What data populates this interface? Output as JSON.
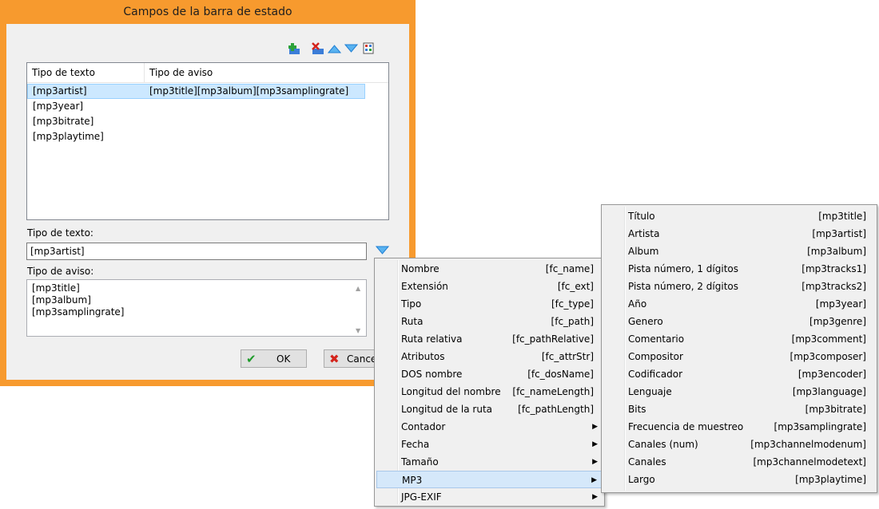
{
  "dialog": {
    "title": "Campos de la barra de estado",
    "toolbar": {
      "add_icon": "add-item-icon",
      "delete_icon": "delete-item-icon",
      "up_icon": "move-up-icon",
      "down_icon": "move-down-icon",
      "settings_icon": "grid-icon"
    },
    "list": {
      "columns": [
        "Tipo de texto",
        "Tipo de aviso"
      ],
      "rows": [
        {
          "text": "[mp3artist]",
          "notice": "[mp3title][mp3album][mp3samplingrate]",
          "selected": true
        },
        {
          "text": "[mp3year]",
          "notice": ""
        },
        {
          "text": "[mp3bitrate]",
          "notice": ""
        },
        {
          "text": "[mp3playtime]",
          "notice": ""
        }
      ]
    },
    "text_type_label": "Tipo de texto:",
    "text_type_value": "[mp3artist]",
    "notice_type_label": "Tipo de aviso:",
    "notice_lines": [
      "[mp3title]",
      "[mp3album]",
      "[mp3samplingrate]"
    ],
    "ok_label": "OK",
    "cancel_label": "Cance"
  },
  "menu_main": {
    "items": [
      {
        "label": "Nombre",
        "value": "[fc_name]"
      },
      {
        "label": "Extensión",
        "value": "[fc_ext]"
      },
      {
        "label": "Tipo",
        "value": "[fc_type]"
      },
      {
        "label": "Ruta",
        "value": "[fc_path]"
      },
      {
        "label": "Ruta relativa",
        "value": "[fc_pathRelative]"
      },
      {
        "label": "Atributos",
        "value": "[fc_attrStr]"
      },
      {
        "label": "DOS nombre",
        "value": "[fc_dosName]"
      },
      {
        "label": "Longitud del nombre",
        "value": "[fc_nameLength]"
      },
      {
        "label": "Longitud de la ruta",
        "value": "[fc_pathLength]"
      },
      {
        "label": "Contador",
        "value": "",
        "submenu": true
      },
      {
        "label": "Fecha",
        "value": "",
        "submenu": true
      },
      {
        "label": "Tamaño",
        "value": "",
        "submenu": true
      },
      {
        "label": "MP3",
        "value": "",
        "submenu": true,
        "highlight": true
      },
      {
        "label": "JPG-EXIF",
        "value": "",
        "submenu": true
      }
    ]
  },
  "menu_mp3": {
    "items": [
      {
        "label": "Título",
        "value": "[mp3title]"
      },
      {
        "label": "Artista",
        "value": "[mp3artist]"
      },
      {
        "label": "Album",
        "value": "[mp3album]"
      },
      {
        "label": "Pista número, 1 dígitos",
        "value": "[mp3tracks1]"
      },
      {
        "label": "Pista número, 2 dígitos",
        "value": "[mp3tracks2]"
      },
      {
        "label": "Año",
        "value": "[mp3year]"
      },
      {
        "label": "Genero",
        "value": "[mp3genre]"
      },
      {
        "label": "Comentario",
        "value": "[mp3comment]"
      },
      {
        "label": "Compositor",
        "value": "[mp3composer]"
      },
      {
        "label": "Codificador",
        "value": "[mp3encoder]"
      },
      {
        "label": "Lenguaje",
        "value": "[mp3language]"
      },
      {
        "label": "Bits",
        "value": "[mp3bitrate]"
      },
      {
        "label": "Frecuencia de muestreo",
        "value": "[mp3samplingrate]"
      },
      {
        "label": "Canales (num)",
        "value": "[mp3channelmodenum]"
      },
      {
        "label": "Canales",
        "value": "[mp3channelmodetext]"
      },
      {
        "label": "Largo",
        "value": "[mp3playtime]"
      }
    ]
  },
  "colors": {
    "frame": "#f79a2e",
    "selection": "#cce8ff",
    "menu_highlight": "#d5e8fa",
    "arrow_blue": "#1f7fd4"
  }
}
